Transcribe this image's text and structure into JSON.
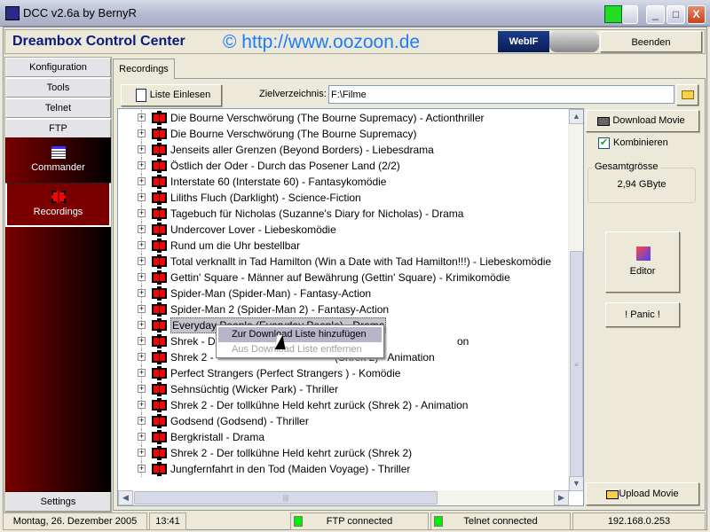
{
  "window": {
    "title": "DCC v2.6a by BernyR",
    "minimize": "_",
    "maximize": "□",
    "close": "X"
  },
  "header": {
    "brand": "Dreambox Control Center",
    "url": "© http://www.oozoon.de",
    "webif_label": "WebIF",
    "exit_label": "Beenden"
  },
  "sidebar": {
    "buttons": [
      "Konfiguration",
      "Tools",
      "Telnet",
      "FTP"
    ],
    "items": [
      {
        "label": "Commander",
        "icon": "grid-icon"
      },
      {
        "label": "Recordings",
        "icon": "film-icon",
        "selected": true
      }
    ],
    "settings": "Settings"
  },
  "tabs": [
    {
      "label": "Recordings",
      "active": true
    }
  ],
  "toolbar": {
    "read_list": "Liste Einlesen",
    "target_label": "Zielverzeichnis:",
    "target_value": "F:\\Filme"
  },
  "recordings": [
    "Die Bourne Verschwörung (The Bourne Supremacy) - Actionthriller",
    "Die Bourne Verschwörung (The Bourne Supremacy)",
    "Jenseits aller Grenzen (Beyond Borders) - Liebesdrama",
    "Östlich der Oder - Durch das Posener Land (2/2)",
    "Interstate 60 (Interstate 60) - Fantasykomödie",
    "Liliths Fluch (Darklight) - Science-Fiction",
    "Tagebuch für Nicholas (Suzanne's Diary for Nicholas) - Drama",
    "Undercover Lover - Liebeskomödie",
    "Rund um die Uhr bestellbar",
    "Total verknallt in Tad Hamilton (Win a Date with Tad Hamilton!!!) - Liebeskomödie",
    "Gettin' Square - Männer auf Bewährung (Gettin' Square) - Krimikomödie",
    "Spider-Man (Spider-Man) - Fantasy-Action",
    "Spider-Man 2 (Spider-Man 2) - Fantasy-Action",
    "Everyday People (Everyday People) - Drama",
    "Shrek - D",
    "Shrek 2 - ",
    "Perfect Strangers (Perfect Strangers ) - Komödie",
    "Sehnsüchtig (Wicker Park) - Thriller",
    "Shrek 2 - Der tollkühne Held kehrt zurück (Shrek 2) - Animation",
    "Godsend (Godsend) - Thriller",
    "Bergkristall - Drama",
    "Shrek 2 - Der tollkühne Held kehrt zurück (Shrek 2)",
    "Jungfernfahrt in den Tod (Maiden Voyage) - Thriller"
  ],
  "partial_tails": {
    "row14": "on",
    "row15": "(Shrek 2) - Animation"
  },
  "selected_index": 13,
  "context_menu": {
    "items": [
      {
        "label": "Zur Download Liste hinzufügen",
        "enabled": true,
        "highlighted": true
      },
      {
        "label": "Aus Download Liste entfernen",
        "enabled": false
      }
    ]
  },
  "right_panel": {
    "download": "Download Movie",
    "combine_label": "Kombinieren",
    "combine_checked": true,
    "total_label": "Gesamtgrösse",
    "total_value": "2,94 GByte",
    "editor": "Editor",
    "panic": "! Panic !",
    "upload": "Upload Movie"
  },
  "statusbar": {
    "date": "Montag, 26. Dezember 2005",
    "time": "13:41",
    "ftp": "FTP connected",
    "telnet": "Telnet connected",
    "ip": "192.168.0.253",
    "led_color": "#00ee00"
  }
}
